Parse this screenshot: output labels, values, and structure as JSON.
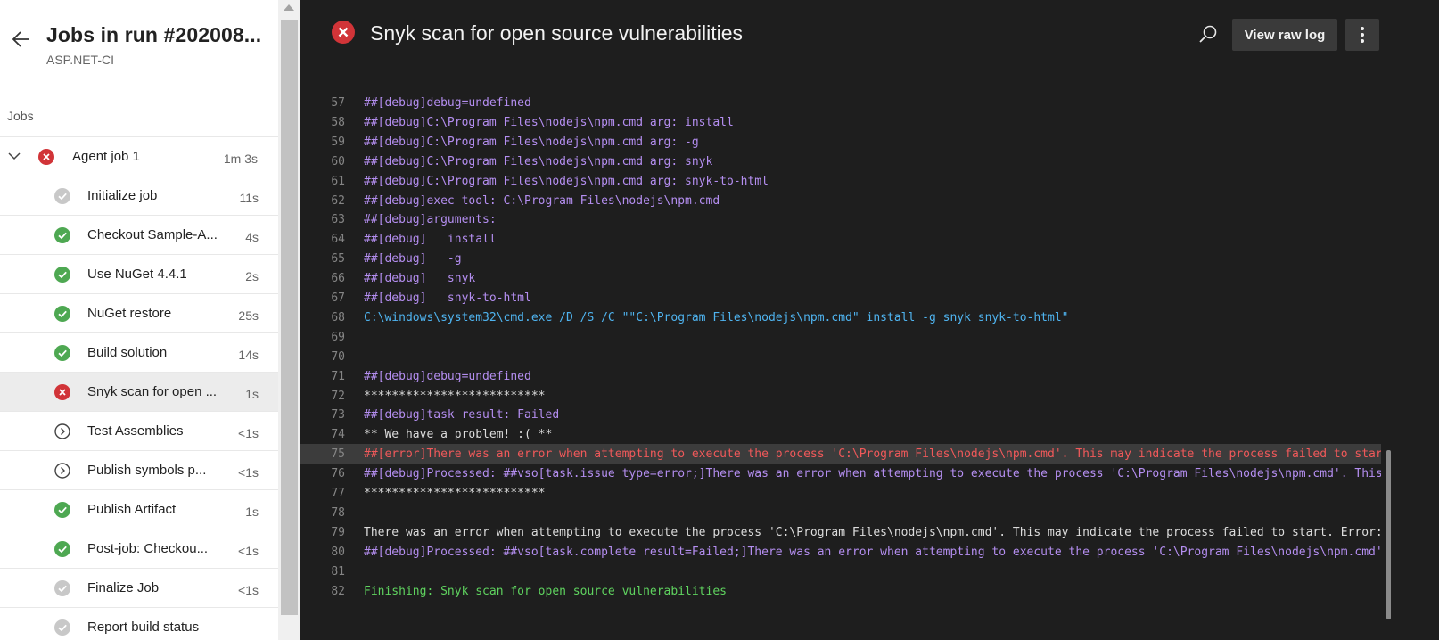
{
  "sidebar": {
    "title": "Jobs in run #202008...",
    "subtitle": "ASP.NET-CI",
    "jobs_label": "Jobs",
    "agent_job": {
      "label": "Agent job 1",
      "duration": "1m 3s",
      "status": "failed"
    },
    "steps": [
      {
        "label": "Initialize job",
        "duration": "11s",
        "status": "skipped"
      },
      {
        "label": "Checkout Sample-A...",
        "duration": "4s",
        "status": "succeeded"
      },
      {
        "label": "Use NuGet 4.4.1",
        "duration": "2s",
        "status": "succeeded"
      },
      {
        "label": "NuGet restore",
        "duration": "25s",
        "status": "succeeded"
      },
      {
        "label": "Build solution",
        "duration": "14s",
        "status": "succeeded"
      },
      {
        "label": "Snyk scan for open ...",
        "duration": "1s",
        "status": "failed"
      },
      {
        "label": "Test Assemblies",
        "duration": "<1s",
        "status": "pending"
      },
      {
        "label": "Publish symbols p...",
        "duration": "<1s",
        "status": "pending"
      },
      {
        "label": "Publish Artifact",
        "duration": "1s",
        "status": "succeeded"
      },
      {
        "label": "Post-job: Checkou...",
        "duration": "<1s",
        "status": "succeeded"
      },
      {
        "label": "Finalize Job",
        "duration": "<1s",
        "status": "skipped"
      },
      {
        "label": "Report build status",
        "duration": "",
        "status": "skipped"
      }
    ],
    "selected_step_index": 5
  },
  "main": {
    "title": "Snyk scan for open source vulnerabilities",
    "view_raw_log_label": "View raw log",
    "highlighted_line": "75",
    "log_lines": [
      {
        "num": "57",
        "text": "##[debug]debug=undefined",
        "kind": "debug"
      },
      {
        "num": "58",
        "text": "##[debug]C:\\Program Files\\nodejs\\npm.cmd arg: install",
        "kind": "debug"
      },
      {
        "num": "59",
        "text": "##[debug]C:\\Program Files\\nodejs\\npm.cmd arg: -g",
        "kind": "debug"
      },
      {
        "num": "60",
        "text": "##[debug]C:\\Program Files\\nodejs\\npm.cmd arg: snyk",
        "kind": "debug"
      },
      {
        "num": "61",
        "text": "##[debug]C:\\Program Files\\nodejs\\npm.cmd arg: snyk-to-html",
        "kind": "debug"
      },
      {
        "num": "62",
        "text": "##[debug]exec tool: C:\\Program Files\\nodejs\\npm.cmd",
        "kind": "debug"
      },
      {
        "num": "63",
        "text": "##[debug]arguments:",
        "kind": "debug"
      },
      {
        "num": "64",
        "text": "##[debug]   install",
        "kind": "debug"
      },
      {
        "num": "65",
        "text": "##[debug]   -g",
        "kind": "debug"
      },
      {
        "num": "66",
        "text": "##[debug]   snyk",
        "kind": "debug"
      },
      {
        "num": "67",
        "text": "##[debug]   snyk-to-html",
        "kind": "debug"
      },
      {
        "num": "68",
        "text": "C:\\windows\\system32\\cmd.exe /D /S /C \"\"C:\\Program Files\\nodejs\\npm.cmd\" install -g snyk snyk-to-html\"",
        "kind": "cmd"
      },
      {
        "num": "69",
        "text": "",
        "kind": "plain"
      },
      {
        "num": "70",
        "text": "",
        "kind": "plain"
      },
      {
        "num": "71",
        "text": "##[debug]debug=undefined",
        "kind": "debug"
      },
      {
        "num": "72",
        "text": "**************************",
        "kind": "plain"
      },
      {
        "num": "73",
        "text": "##[debug]task result: Failed",
        "kind": "debug"
      },
      {
        "num": "74",
        "text": "** We have a problem! :( **",
        "kind": "plain"
      },
      {
        "num": "75",
        "text": "##[error]There was an error when attempting to execute the process 'C:\\Program Files\\nodejs\\npm.cmd'. This may indicate the process failed to start. Error: sp",
        "kind": "error"
      },
      {
        "num": "76",
        "text": "##[debug]Processed: ##vso[task.issue type=error;]There was an error when attempting to execute the process 'C:\\Program Files\\nodejs\\npm.cmd'. This may indicat",
        "kind": "debug"
      },
      {
        "num": "77",
        "text": "**************************",
        "kind": "plain"
      },
      {
        "num": "78",
        "text": "",
        "kind": "plain"
      },
      {
        "num": "79",
        "text": "There was an error when attempting to execute the process 'C:\\Program Files\\nodejs\\npm.cmd'. This may indicate the process failed to start. Error: spawn C:\\wi",
        "kind": "plain"
      },
      {
        "num": "80",
        "text": "##[debug]Processed: ##vso[task.complete result=Failed;]There was an error when attempting to execute the process 'C:\\Program Files\\nodejs\\npm.cmd'. This may i",
        "kind": "debug"
      },
      {
        "num": "81",
        "text": "",
        "kind": "plain"
      },
      {
        "num": "82",
        "text": "Finishing: Snyk scan for open source vulnerabilities",
        "kind": "success"
      }
    ]
  },
  "colors": {
    "failed": "#d13438",
    "succeeded": "#4ea852",
    "skipped": "#c8c8c8",
    "pending": "#444444",
    "debug": "#b48ef0",
    "error": "#f0595a",
    "success": "#5fd35f",
    "cmd": "#4fb4f0"
  }
}
